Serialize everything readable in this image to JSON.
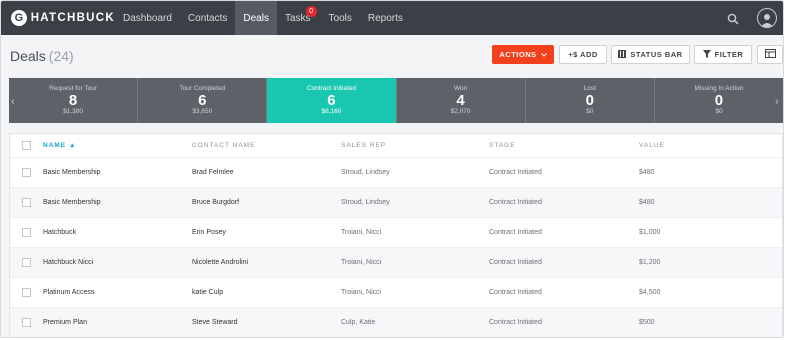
{
  "brand": {
    "logo_text": "HATCHBUCK",
    "logo_mark": "G"
  },
  "nav": {
    "items": [
      {
        "label": "Dashboard"
      },
      {
        "label": "Contacts"
      },
      {
        "label": "Deals"
      },
      {
        "label": "Tasks",
        "badge": "0"
      },
      {
        "label": "Tools"
      },
      {
        "label": "Reports"
      }
    ],
    "active": "Deals"
  },
  "header": {
    "title": "Deals",
    "count": "(24)",
    "buttons": {
      "actions": "Actions",
      "add": "+$ Add",
      "status_bar": "Status Bar",
      "filter": "Filter"
    }
  },
  "stages": [
    {
      "label": "Request for Tour",
      "count": "8",
      "total": "$1,380"
    },
    {
      "label": "Tour Completed",
      "count": "6",
      "total": "$3,650"
    },
    {
      "label": "Contract Initiated",
      "count": "6",
      "total": "$8,160",
      "active": true
    },
    {
      "label": "Won",
      "count": "4",
      "total": "$2,070"
    },
    {
      "label": "Lost",
      "count": "0",
      "total": "$0"
    },
    {
      "label": "Missing In Action",
      "count": "0",
      "total": "$0"
    }
  ],
  "table": {
    "columns": [
      "Name",
      "Contact Name",
      "Sales Rep",
      "Stage",
      "Value"
    ],
    "rows": [
      {
        "name": "Basic Membership",
        "contact": "Brad Felmlee",
        "rep": "Stroud, Lindsey",
        "stage": "Contract Initiated",
        "value": "$480"
      },
      {
        "name": "Basic Membership",
        "contact": "Bruce Burgdorf",
        "rep": "Stroud, Lindsey",
        "stage": "Contract Initiated",
        "value": "$480"
      },
      {
        "name": "Hatchbuck",
        "contact": "Erin Posey",
        "rep": "Troiani, Nicci",
        "stage": "Contract Initiated",
        "value": "$1,000"
      },
      {
        "name": "Hatchbuck Nicci",
        "contact": "Nicolette Androlini",
        "rep": "Troiani, Nicci",
        "stage": "Contract Initiated",
        "value": "$1,200"
      },
      {
        "name": "Platinum Access",
        "contact": "katie Culp",
        "rep": "Troiani, Nicci",
        "stage": "Contract Initiated",
        "value": "$4,500"
      },
      {
        "name": "Premium Plan",
        "contact": "Steve Steward",
        "rep": "Culp, Katie",
        "stage": "Contract Initiated",
        "value": "$500"
      }
    ]
  },
  "colors": {
    "accent": "#19c7b0",
    "actions": "#f3401d",
    "nav_bg": "#3b3f46",
    "sort": "#1a9fd6"
  },
  "icons": [
    "search-icon",
    "user-avatar-icon",
    "chevron-down-icon",
    "bars-icon",
    "filter-icon",
    "columns-icon",
    "chevron-left-icon",
    "chevron-right-icon",
    "sort-up-icon"
  ]
}
